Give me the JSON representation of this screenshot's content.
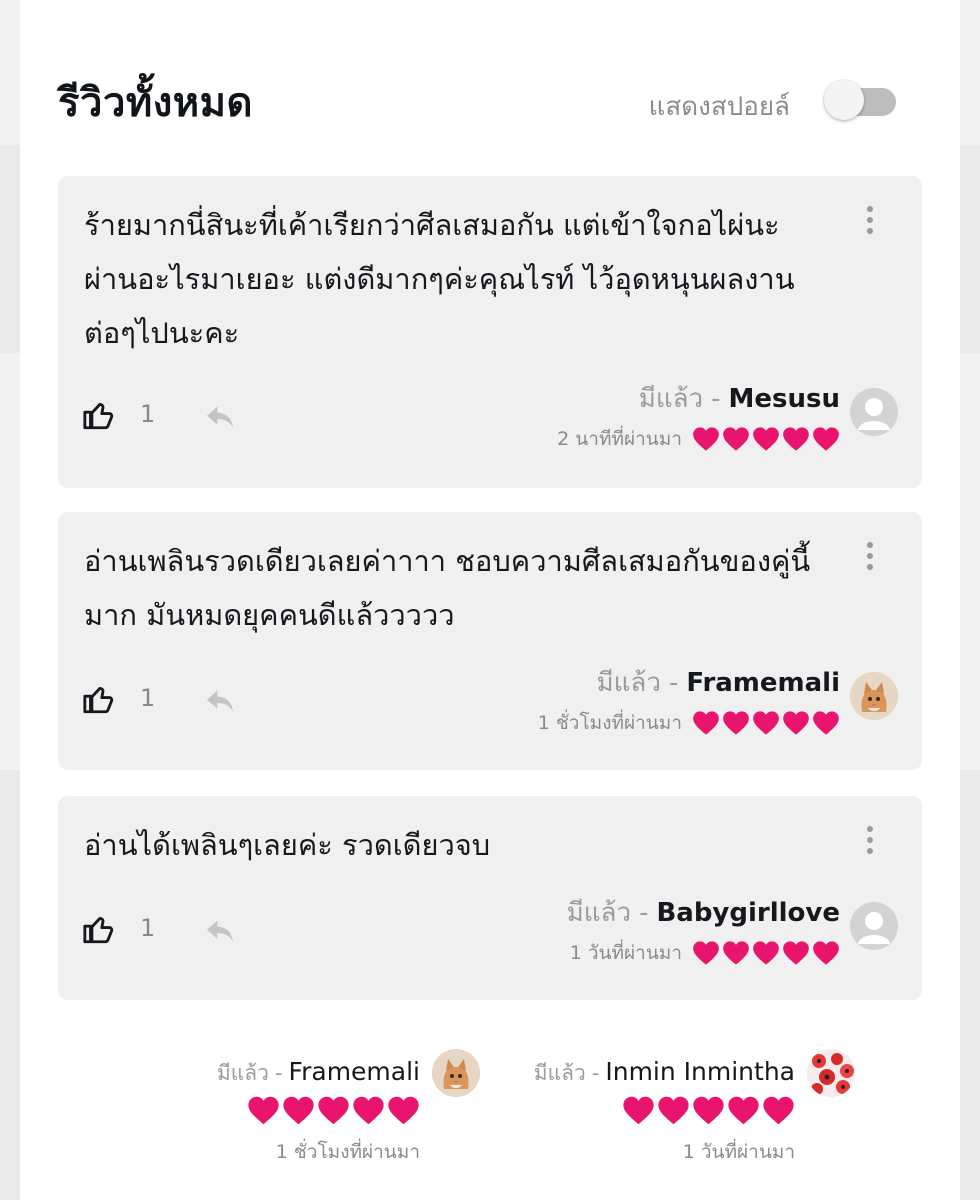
{
  "header": {
    "title": "รีวิวทั้งหมด",
    "spoiler_label": "แสดงสปอยล์",
    "spoiler_enabled": false
  },
  "colors": {
    "heart": "#e8146e",
    "card_bg": "#f0f0f0",
    "page_bg": "#ffffff"
  },
  "reviews": [
    {
      "text": "ร้ายมากนี่สินะที่เค้าเรียกว่าศีลเสมอกัน แต่เข้าใจกอไผ่นะผ่านอะไรมาเยอะ แต่งดีมากๆค่ะคุณไรท์ ไว้อุดหนุนผลงานต่อๆไปนะคะ",
      "likes": "1",
      "status": "มีแล้ว",
      "dash": "-",
      "author": "Mesusu",
      "time": "2 นาทีที่ผ่านมา",
      "rating": 5,
      "avatar_icon": "default-user-avatar"
    },
    {
      "text": "อ่านเพลินรวดเดียวเลยค่าาาา ชอบความศีลเสมอกันของคู่นี้มาก มันหมดยุคคนดีแล้ววววว",
      "likes": "1",
      "status": "มีแล้ว",
      "dash": "-",
      "author": "Framemali",
      "time": "1 ชั่วโมงที่ผ่านมา",
      "rating": 5,
      "avatar_icon": "kitten-avatar"
    },
    {
      "text": "อ่านได้เพลินๆเลยค่ะ รวดเดียวจบ",
      "likes": "1",
      "status": "มีแล้ว",
      "dash": "-",
      "author": "Babygirllove",
      "time": "1 วันที่ผ่านมา",
      "rating": 5,
      "avatar_icon": "default-user-avatar"
    }
  ],
  "mini_reviews": [
    {
      "status": "มีแล้ว",
      "dash": "-",
      "author": "Framemali",
      "time": "1 ชั่วโมงที่ผ่านมา",
      "rating": 5,
      "avatar_icon": "kitten-avatar"
    },
    {
      "status": "มีแล้ว",
      "dash": "-",
      "author": "Inmin Inmintha",
      "time": "1 วันที่ผ่านมา",
      "rating": 5,
      "avatar_icon": "flower-avatar"
    }
  ]
}
